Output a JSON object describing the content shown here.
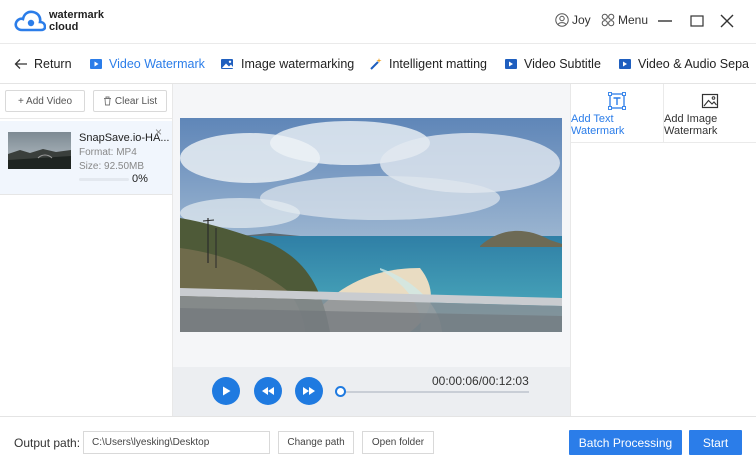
{
  "app": {
    "logo_line1": "watermark",
    "logo_line2": "cloud",
    "user_name": "Joy",
    "menu_label": "Menu"
  },
  "tabs": [
    {
      "label": "Return",
      "icon": "arrow-left-icon",
      "active": false
    },
    {
      "label": "Video Watermark",
      "icon": "video-watermark-icon",
      "active": true
    },
    {
      "label": "Image watermarking",
      "icon": "image-watermark-icon",
      "active": false
    },
    {
      "label": "Intelligent matting",
      "icon": "magic-wand-icon",
      "active": false
    },
    {
      "label": "Video Subtitle",
      "icon": "video-subtitle-icon",
      "active": false
    },
    {
      "label": "Video & Audio Sepa",
      "icon": "video-audio-icon",
      "active": false
    }
  ],
  "file_panel": {
    "add_video": "+ Add Video",
    "clear_list": "Clear List",
    "file": {
      "name": "SnapSave.io-HA...",
      "format": "Format:  MP4",
      "size": "Size:  92.50MB",
      "progress_pct": "0%",
      "progress_value": 0
    }
  },
  "player": {
    "time": "00:00:06/00:12:03",
    "position_fraction": 0.0083
  },
  "watermark_options": [
    {
      "label_line1": "Add Text",
      "label_line2": "Watermark",
      "icon": "text-box-icon",
      "active": true
    },
    {
      "label_line1": "Add Image",
      "label_line2": "Watermark",
      "icon": "image-frame-icon",
      "active": false
    }
  ],
  "bottom": {
    "output_label": "Output path:",
    "output_path": "C:\\Users\\lyesking\\Desktop",
    "change_path": "Change path",
    "open_folder": "Open folder",
    "batch_processing": "Batch Processing",
    "start": "Start"
  },
  "colors": {
    "accent": "#2b7de9",
    "control_blue": "#1f7ae0",
    "selected_row": "#f1f6fd"
  }
}
